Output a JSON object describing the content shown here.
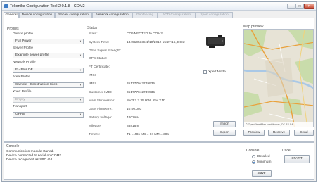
{
  "window": {
    "title": "Teltonika Configuration Tool 2.0.1.8 - COM2"
  },
  "window_buttons": {
    "minimize": "–",
    "maximize": "□",
    "close": "✕"
  },
  "tabs": [
    {
      "label": "General",
      "state": "active"
    },
    {
      "label": "Device configuration",
      "state": "normal"
    },
    {
      "label": "Server configuration",
      "state": "normal"
    },
    {
      "label": "Network configuration",
      "state": "normal"
    },
    {
      "label": "Geofencing",
      "state": "disabled"
    },
    {
      "label": "ADD Configuration",
      "state": "disabled"
    },
    {
      "label": "Xpert configuration",
      "state": "disabled"
    }
  ],
  "profiles": {
    "title": "Profiles",
    "device_profile": {
      "label": "Device profile",
      "value": "Full Power"
    },
    "server_profile": {
      "label": "Server Profile",
      "value": "Example server profile"
    },
    "network_profile": {
      "label": "Network Profile",
      "value": "E - Plus DE"
    },
    "area_profile": {
      "label": "Area Profile",
      "value": "Sample - Construction Sites"
    },
    "xpert_profile": {
      "label": "Xpert Profile",
      "value": "Empty"
    },
    "transport": {
      "label": "Transport",
      "value": "GPRS"
    }
  },
  "status": {
    "title": "Status",
    "rows": [
      {
        "label": "State:",
        "value": "CONNECTED to COM2"
      },
      {
        "label": "System Time:",
        "value": "1349105335 1/10/2012 15:27:15, EC:2"
      },
      {
        "label": "GSM Signal Strength:",
        "value": ""
      },
      {
        "label": "GPS Status:",
        "value": ""
      },
      {
        "label": "FT Certificate:",
        "value": ""
      },
      {
        "label": "IMSI:",
        "value": ""
      },
      {
        "label": "IMEI:",
        "value": "351777042749935"
      },
      {
        "label": "Customer IMEI:",
        "value": "351777042749935"
      },
      {
        "label": "Main SW version:",
        "value": "sbc3|2.3.35  HW: Rev.X1b"
      },
      {
        "label": "GSM Firmware:",
        "value": "10.00.003"
      },
      {
        "label": "Battery voltage:",
        "value": "4202mV"
      },
      {
        "label": "Mileage:",
        "value": "88816m"
      },
      {
        "label": "Timers:",
        "value": "T1 = 48s  MS = 0s  NM = 30s"
      }
    ],
    "xpert_mode": "Xpert Mode",
    "import_button": "Import",
    "export_button": "Export"
  },
  "map": {
    "title": "Map preview",
    "footer": "© OpenStreetMap contributors, CC-BY-SA",
    "preview_button": "Preview",
    "receive_button": "Receive",
    "send_button": "Send"
  },
  "console": {
    "title": "Console",
    "lines": [
      "Communication module started.",
      "Device connected to serial on COM2",
      "Device recognized as SBC AVL"
    ],
    "settings_title": "Console",
    "detailed": "Detailed",
    "minimum": "Minimum",
    "selected": "minimum",
    "save_button": "Save",
    "trace_title": "Trace",
    "start_button": "START"
  },
  "colors": {
    "accent": "#3a7dc9",
    "map_green": "#c9dcab",
    "map_water": "#a9c8e6"
  }
}
